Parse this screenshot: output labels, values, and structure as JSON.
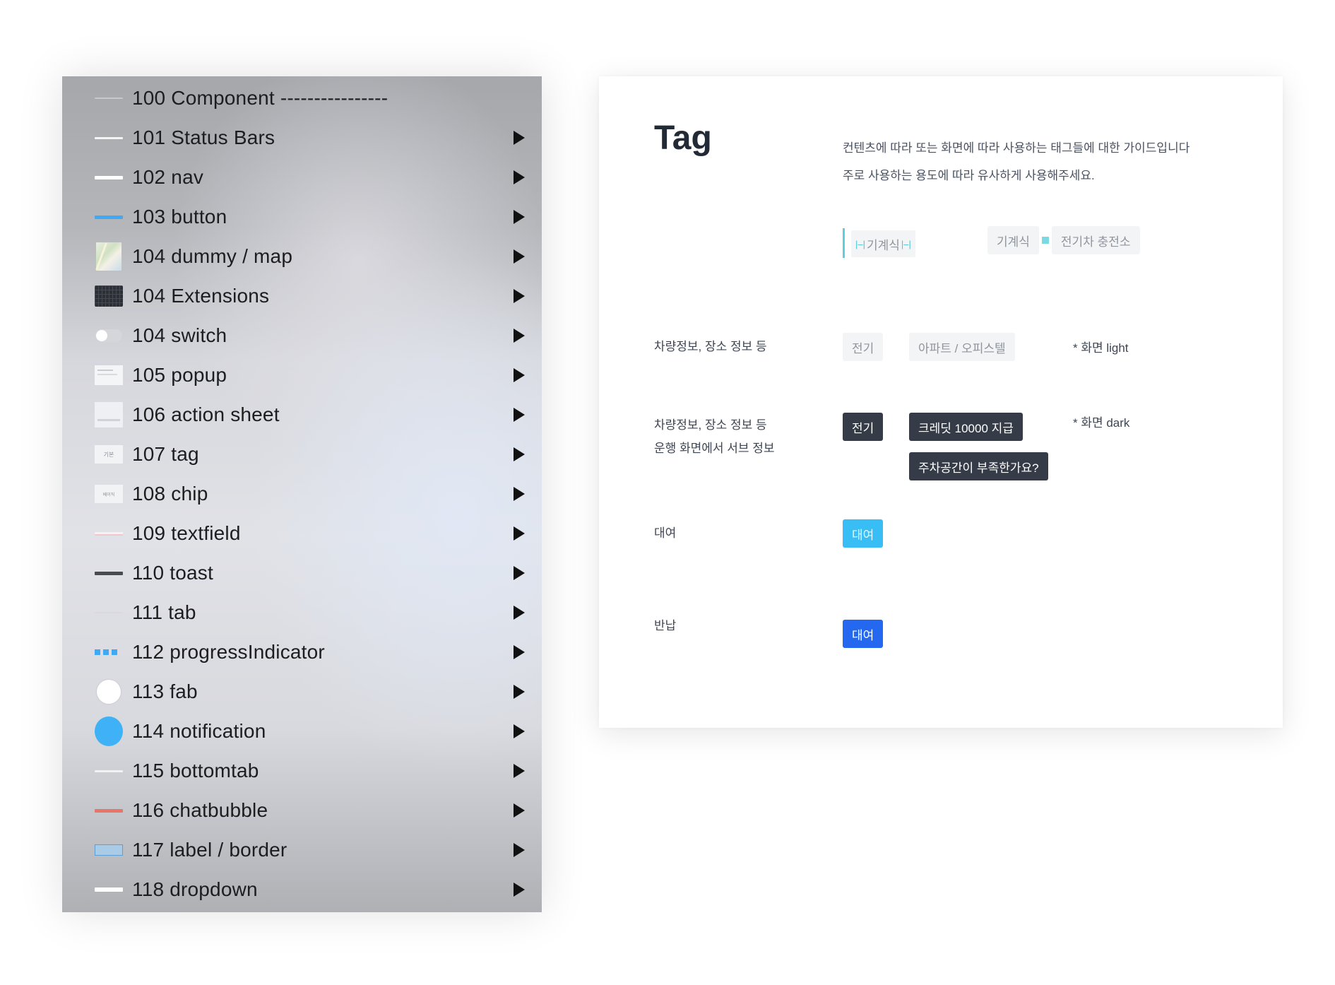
{
  "menu": {
    "items": [
      {
        "label": "100 Component ----------------",
        "thumb": "separator-line",
        "color": "#d0d2d6",
        "has_arrow": false
      },
      {
        "label": "101 Status Bars",
        "thumb": "line",
        "color": "#f4f4f5",
        "has_arrow": true
      },
      {
        "label": "102 nav",
        "thumb": "line",
        "color": "#ffffff",
        "has_arrow": true
      },
      {
        "label": "103 button",
        "thumb": "line",
        "color": "#3fa9f5",
        "has_arrow": true
      },
      {
        "label": "104 dummy / map",
        "thumb": "map-thumbnail",
        "has_arrow": true
      },
      {
        "label": "104 Extensions",
        "thumb": "keyboard-thumbnail",
        "has_arrow": true
      },
      {
        "label": "104 switch",
        "thumb": "switch-thumbnail",
        "has_arrow": true
      },
      {
        "label": "105 popup",
        "thumb": "card-thumbnail",
        "has_arrow": true
      },
      {
        "label": "106 action sheet",
        "thumb": "sheet-thumbnail",
        "has_arrow": true
      },
      {
        "label": "107 tag",
        "thumb": "tag-thumbnail",
        "thumb_text": "기본",
        "has_arrow": true
      },
      {
        "label": "108 chip",
        "thumb": "tag-thumbnail",
        "thumb_text": "베이직",
        "has_arrow": true
      },
      {
        "label": "109 textfield",
        "thumb": "line",
        "color": "#f1c7cb",
        "has_arrow": true
      },
      {
        "label": "110 toast",
        "thumb": "line",
        "color": "#474b52",
        "has_arrow": true
      },
      {
        "label": "111 tab",
        "thumb": "line",
        "color": "#d9dadd",
        "has_arrow": true
      },
      {
        "label": "112 progressIndicator",
        "thumb": "dots",
        "color": "#3fa9f5",
        "has_arrow": true
      },
      {
        "label": "113 fab",
        "thumb": "fab-circle",
        "color": "#ffffff",
        "has_arrow": true
      },
      {
        "label": "114 notification",
        "thumb": "notification-circle",
        "color": "#3fb2f7",
        "has_arrow": true
      },
      {
        "label": "115 bottomtab",
        "thumb": "line",
        "color": "#f2f2f3",
        "has_arrow": true
      },
      {
        "label": "116 chatbubble",
        "thumb": "line",
        "color": "#e8746a",
        "has_arrow": true
      },
      {
        "label": "117 label / border",
        "thumb": "label-box",
        "color": "#5b9fd6",
        "has_arrow": true
      },
      {
        "label": "118 dropdown",
        "thumb": "line",
        "color": "#ffffff",
        "has_arrow": true
      }
    ]
  },
  "guide": {
    "title": "Tag",
    "description_line1": "컨텐츠에 따라 또는 화면에 따라 사용하는 태그들에 대한 가이드입니다",
    "description_line2": "주로 사용하는 용도에 따라 유사하게 사용해주세요.",
    "spec": {
      "single_tag": "기계식",
      "pair_first": "기계식",
      "pair_second": "전기차 충전소"
    },
    "rows": [
      {
        "label_lines": [
          "차량정보, 장소 정보 등"
        ],
        "tags": [
          "전기",
          "아파트 / 오피스텔"
        ],
        "note": "* 화면 light"
      },
      {
        "label_lines": [
          "차량정보, 장소 정보 등",
          "운행 화면에서 서브 정보"
        ],
        "tags": [
          "전기",
          "크레딧 10000 지급",
          "주차공간이 부족한가요?"
        ],
        "note": "* 화면 dark"
      },
      {
        "label_lines": [
          "대여"
        ],
        "tags": [
          "대여"
        ]
      },
      {
        "label_lines": [
          "반납"
        ],
        "tags": [
          "대여"
        ]
      }
    ],
    "colors": {
      "light_tag_bg": "#f3f4f6",
      "dark_tag_bg": "#353c47",
      "cyan_tag_bg": "#39bdf5",
      "blue_tag_bg": "#2468f0",
      "spec_marker": "#5ad0dd"
    }
  }
}
